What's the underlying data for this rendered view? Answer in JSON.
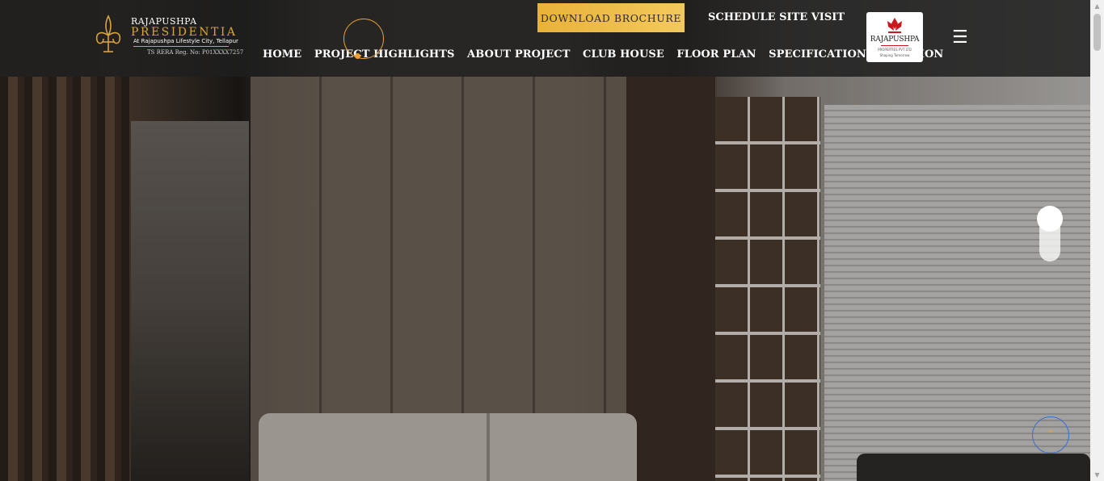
{
  "header": {
    "logo": {
      "brand": "RAJAPUSHPA",
      "name": "PRESIDENTIA",
      "subtitle": "At Rajapushpa Lifestyle City, Tellapur",
      "rera": "TS RERA Reg. No: P01XXXX7257"
    },
    "nav": [
      {
        "label": "HOME"
      },
      {
        "label": "PROJECT HIGHLIGHTS"
      },
      {
        "label": "ABOUT PROJECT"
      },
      {
        "label": "CLUB HOUSE"
      },
      {
        "label": "FLOOR PLAN"
      },
      {
        "label": "SPECIFICATION"
      },
      {
        "label": "LOCATION"
      }
    ],
    "brochure_label": "DOWNLOAD BROCHURE",
    "visit_label": "SCHEDULE SITE VISIT",
    "developer": {
      "name": "RAJAPUSHPA",
      "sub": "PROPERTIES PVT LTD",
      "tag": "Shaping Tomorrow"
    },
    "menu_icon": "☰"
  },
  "back_to_top_icon": "⌃",
  "icons": {
    "menu": "hamburger-icon",
    "top": "chevron-up-icon"
  },
  "colors": {
    "accent": "#e9b23a",
    "header_bg": "#1e1e1e",
    "brand_red": "#c9181e"
  },
  "scrollbar": {
    "up": "▲",
    "down": "▼"
  }
}
